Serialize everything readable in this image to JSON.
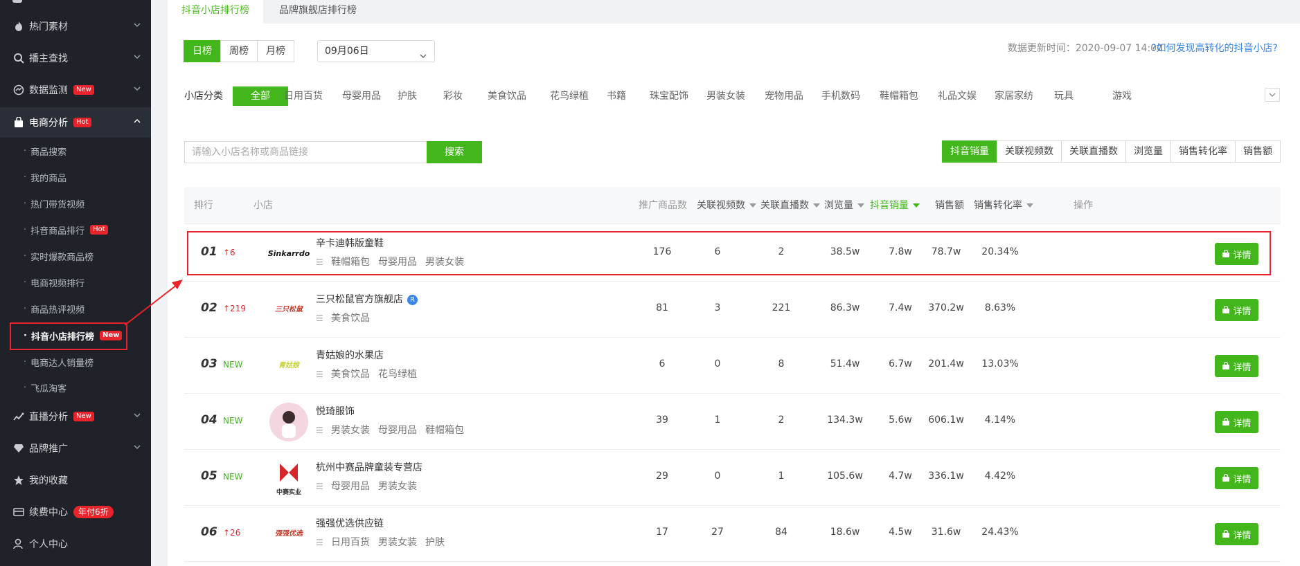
{
  "sidebar": {
    "items": [
      {
        "label": "热门素材",
        "icon": "fire-icon"
      },
      {
        "label": "播主查找",
        "icon": "search-icon"
      },
      {
        "label": "数据监测",
        "icon": "monitor-icon",
        "badge": "New"
      },
      {
        "label": "电商分析",
        "icon": "shopping-bag-icon",
        "badge": "Hot"
      }
    ],
    "sub_items": [
      {
        "label": "商品搜索"
      },
      {
        "label": "我的商品"
      },
      {
        "label": "热门带货视频"
      },
      {
        "label": "抖音商品排行",
        "badge": "Hot"
      },
      {
        "label": "实时爆款商品榜"
      },
      {
        "label": "电商视频排行"
      },
      {
        "label": "商品热评视频"
      },
      {
        "label": "抖音小店排行榜",
        "badge": "New"
      },
      {
        "label": "电商达人销量榜"
      },
      {
        "label": "飞瓜淘客"
      }
    ],
    "bottom_items": [
      {
        "label": "直播分析",
        "icon": "live-chart-icon",
        "badge": "New"
      },
      {
        "label": "品牌推广",
        "icon": "diamond-icon"
      },
      {
        "label": "我的收藏",
        "icon": "star-icon"
      },
      {
        "label": "续费中心",
        "icon": "card-icon",
        "badge": "年付6折"
      },
      {
        "label": "个人中心",
        "icon": "user-icon"
      }
    ]
  },
  "tabs": [
    {
      "label": "抖音小店排行榜"
    },
    {
      "label": "品牌旗舰店排行榜"
    }
  ],
  "period": {
    "options": [
      "日榜",
      "周榜",
      "月榜"
    ],
    "date": "09月06日"
  },
  "update_text": "数据更新时间：2020-09-07 14:00",
  "help_link": "?如何发现高转化的抖音小店?",
  "categories": {
    "label": "小店分类",
    "items": [
      "全部",
      "日用百货",
      "母婴用品",
      "护肤",
      "彩妆",
      "美食饮品",
      "花鸟绿植",
      "书籍",
      "珠宝配饰",
      "男装女装",
      "宠物用品",
      "手机数码",
      "鞋帽箱包",
      "礼品文娱",
      "家居家纺",
      "玩具",
      "游戏"
    ]
  },
  "search": {
    "placeholder": "请输入小店名称或商品链接",
    "button": "搜索"
  },
  "sort_tabs": [
    "抖音销量",
    "关联视频数",
    "关联直播数",
    "浏览量",
    "销售转化率",
    "销售额"
  ],
  "table": {
    "headers": [
      "排行",
      "小店",
      "推广商品数",
      "关联视频数",
      "关联直播数",
      "浏览量",
      "抖音销量",
      "销售额",
      "销售转化率",
      "操作"
    ],
    "detail_label": "详情",
    "rows": [
      {
        "rank": "01",
        "change": "↑6",
        "change_type": "up",
        "name": "辛卡迪韩版童鞋",
        "tags": [
          "鞋帽箱包",
          "母婴用品",
          "男装女装"
        ],
        "logo_text": "Sinkarrdo",
        "products": "176",
        "videos": "6",
        "lives": "2",
        "views": "38.5w",
        "sales": "7.8w",
        "revenue": "78.7w",
        "conversion": "20.34%"
      },
      {
        "rank": "02",
        "change": "↑219",
        "change_type": "up",
        "name": "三只松鼠官方旗舰店",
        "badge": "R",
        "tags": [
          "美食饮品"
        ],
        "logo_text": "三只松鼠",
        "products": "81",
        "videos": "3",
        "lives": "221",
        "views": "86.3w",
        "sales": "7.4w",
        "revenue": "370.2w",
        "conversion": "8.63%"
      },
      {
        "rank": "03",
        "change": "NEW",
        "change_type": "new",
        "name": "青姑娘的水果店",
        "tags": [
          "美食饮品",
          "花鸟绿植"
        ],
        "logo_text": "青姑娘",
        "products": "6",
        "videos": "0",
        "lives": "8",
        "views": "51.4w",
        "sales": "6.7w",
        "revenue": "201.4w",
        "conversion": "13.03%"
      },
      {
        "rank": "04",
        "change": "NEW",
        "change_type": "new",
        "name": "悦琦服饰",
        "tags": [
          "男装女装",
          "母婴用品",
          "鞋帽箱包"
        ],
        "logo_text": "",
        "products": "39",
        "videos": "1",
        "lives": "2",
        "views": "134.3w",
        "sales": "5.6w",
        "revenue": "606.1w",
        "conversion": "4.14%"
      },
      {
        "rank": "05",
        "change": "NEW",
        "change_type": "new",
        "name": "杭州中赛品牌童装专营店",
        "tags": [
          "母婴用品",
          "男装女装"
        ],
        "logo_text": "中赛实业",
        "products": "29",
        "videos": "0",
        "lives": "1",
        "views": "105.6w",
        "sales": "4.7w",
        "revenue": "336.1w",
        "conversion": "4.42%"
      },
      {
        "rank": "06",
        "change": "↑26",
        "change_type": "up",
        "name": "强强优选供应链",
        "tags": [
          "日用百货",
          "男装女装",
          "护肤"
        ],
        "logo_text": "强强优选",
        "products": "17",
        "videos": "27",
        "lives": "84",
        "views": "18.6w",
        "sales": "4.5w",
        "revenue": "31.6w",
        "conversion": "24.43%"
      }
    ]
  },
  "colors": {
    "accent": "#43b61c",
    "alert": "#e8232a",
    "link": "#3a86e8",
    "sidebar": "#1f2229"
  }
}
